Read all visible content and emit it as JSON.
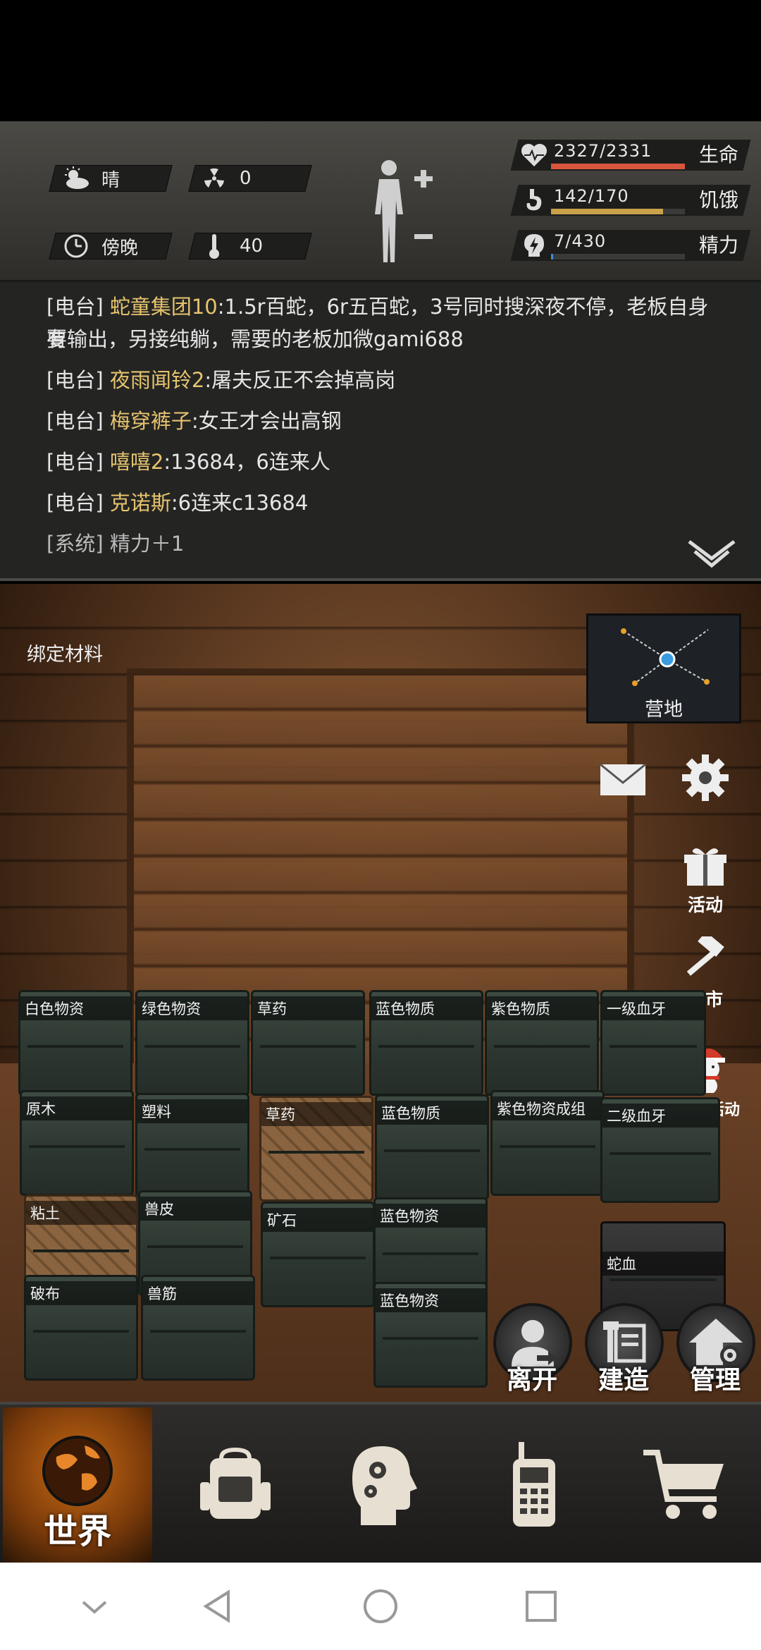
{
  "status": {
    "weather": "晴",
    "radiation": "0",
    "time_of_day": "傍晚",
    "temperature": "40",
    "health": {
      "value": "2327/2331",
      "label": "生命",
      "ratio": 0.998,
      "color": "#d8563e"
    },
    "hunger": {
      "value": "142/170",
      "label": "饥饿",
      "ratio": 0.835,
      "color": "#c9a24a"
    },
    "energy": {
      "value": "7/430",
      "label": "精力",
      "ratio": 0.016,
      "color": "#3b8fd4"
    }
  },
  "chat": [
    {
      "tag": "[电台]",
      "name": "蛇童集团10",
      "text": ":1.5r百蛇，6r五百蛇，3号同时搜深夜不停，老板自身要"
    },
    {
      "tag": "",
      "name": "",
      "text": "有输出，另接纯躺，需要的老板加微gami688"
    },
    {
      "tag": "[电台]",
      "name": "夜雨闻铃2",
      "text": ":屠夫反正不会掉高岗"
    },
    {
      "tag": "[电台]",
      "name": "梅穿裤子",
      "text": ":女王才会出高钢"
    },
    {
      "tag": "[电台]",
      "name": "嘻嘻2",
      "text": ":13684，6连来人"
    },
    {
      "tag": "[电台]",
      "name": "克诺斯",
      "text": ":6连来c13684"
    },
    {
      "tag": "[系统]",
      "name": "",
      "text": "精力＋1"
    }
  ],
  "room": {
    "bind_label": "绑定材料",
    "minimap_label": "营地",
    "side": {
      "activity": "活动",
      "black_market": "黑市",
      "new_year": "双旦活动"
    },
    "crates": [
      "白色物资",
      "绿色物资",
      "草药",
      "蓝色物质",
      "紫色物质",
      "一级血牙",
      "原木",
      "塑料",
      "草药",
      "蓝色物质",
      "紫色物资成组",
      "二级血牙",
      "粘土",
      "兽皮",
      "矿石",
      "蓝色物资",
      "蛇血",
      "破布",
      "兽筋",
      "蓝色物资"
    ],
    "actions": {
      "leave": "离开",
      "build": "建造",
      "manage": "管理"
    }
  },
  "tabs": {
    "world": "世界"
  }
}
